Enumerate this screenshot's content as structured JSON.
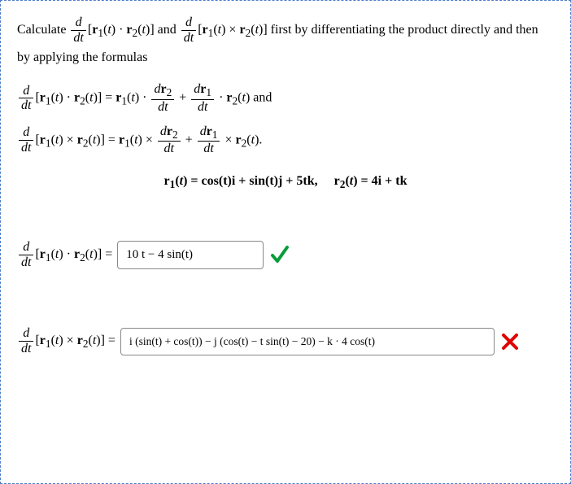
{
  "prompt": {
    "part1": "Calculate ",
    "part2": " and ",
    "part3": " first by differentiating the product directly and then by applying the formulas"
  },
  "formulas": {
    "dot_suffix": " and",
    "cross_suffix": "."
  },
  "given": {
    "r1_def": "cos(t)i + sin(t)j + 5tk,",
    "r2_def": "4i + tk"
  },
  "answers": {
    "dot_value": "10 t − 4  sin(t)",
    "cross_value": "i (sin(t) + cos(t)) − j (cos(t) − t sin(t) − 20) − k · 4 cos(t)"
  },
  "icons": {
    "check": "check-icon",
    "cross": "cross-icon"
  }
}
